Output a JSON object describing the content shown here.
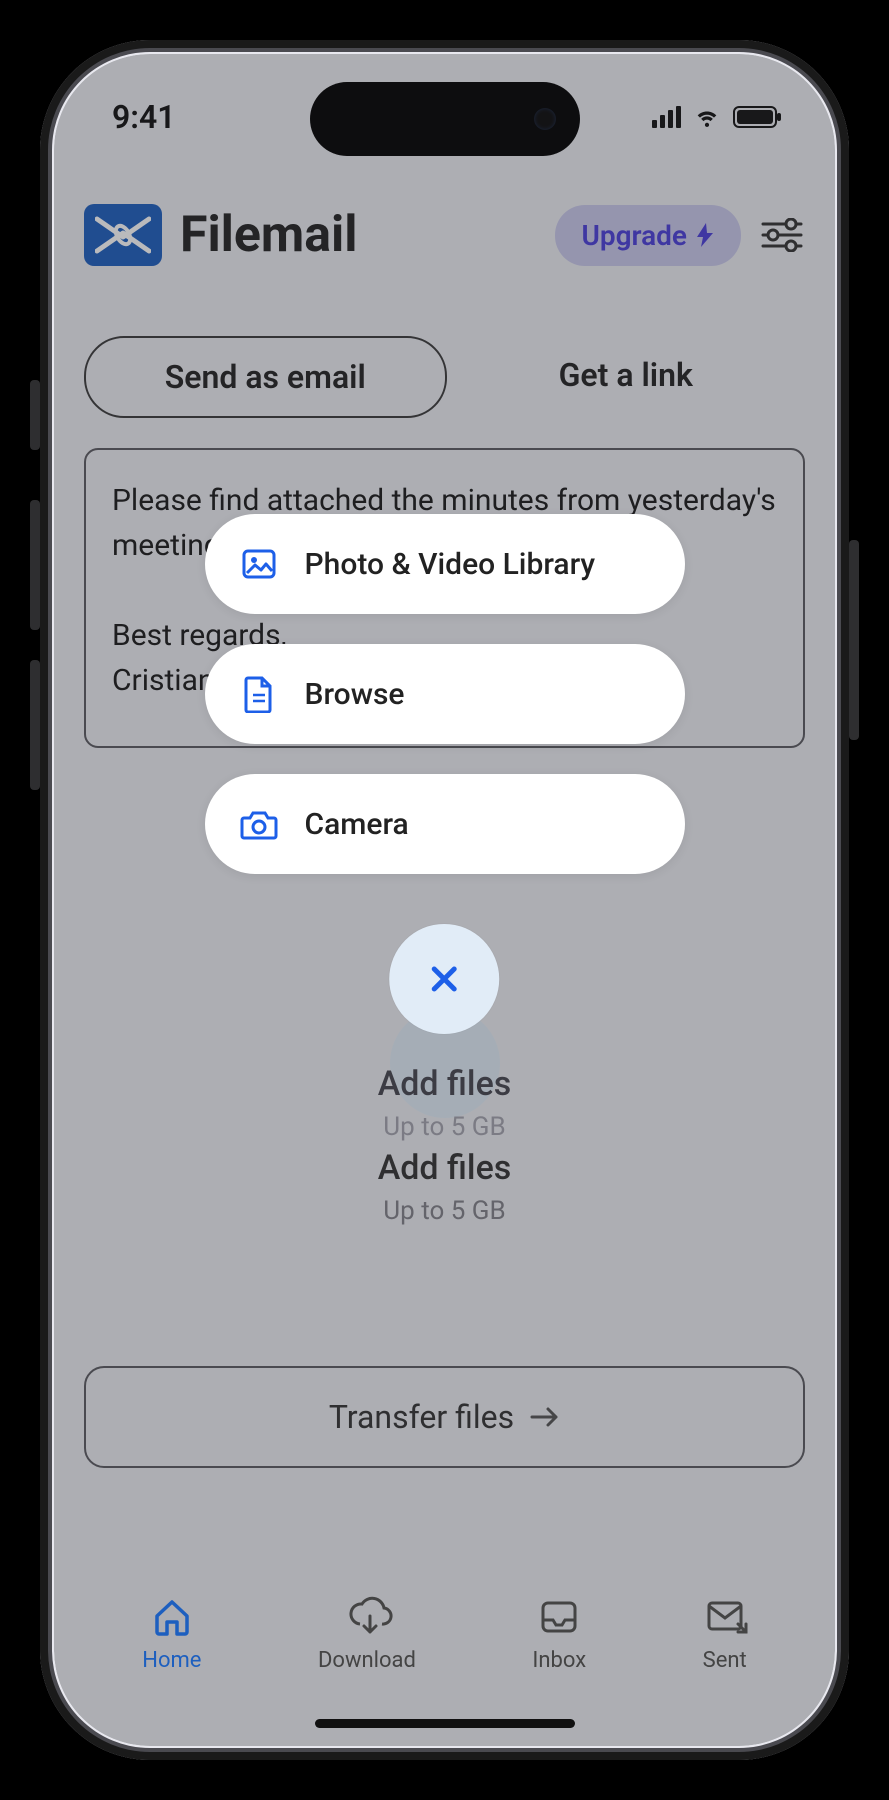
{
  "status": {
    "time": "9:41"
  },
  "header": {
    "app_name": "Filemail",
    "upgrade_label": "Upgrade"
  },
  "tabs": {
    "send_email": "Send as email",
    "get_link": "Get a link"
  },
  "message": "Please find attached the minutes from yesterday's meeting, for review and reference.\n\nBest regards,\nCristian",
  "add_files": {
    "title": "Add files",
    "subtitle": "Up to 5 GB"
  },
  "transfer": {
    "label": "Transfer files"
  },
  "popover": {
    "photo_video": "Photo & Video Library",
    "browse": "Browse",
    "camera": "Camera"
  },
  "tabbar": {
    "home": "Home",
    "download": "Download",
    "inbox": "Inbox",
    "sent": "Sent"
  }
}
